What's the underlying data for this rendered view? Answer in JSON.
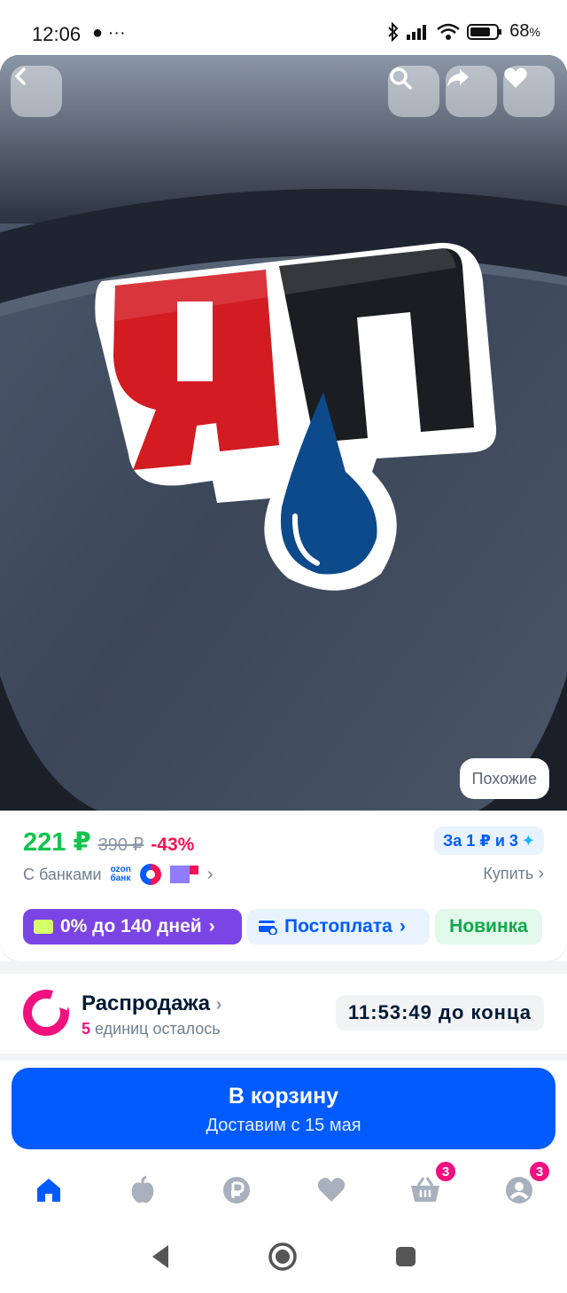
{
  "status_bar": {
    "time": "12:06",
    "extra": "●  ···",
    "battery": "68",
    "battery_unit": "%",
    "icons": [
      "bluetooth-icon",
      "signal-icon",
      "wifi-icon",
      "battery-icon"
    ]
  },
  "hero": {
    "logo_letters": "ЯП",
    "similar_label": "Похожие",
    "buttons": [
      "back-icon",
      "search-icon",
      "share-icon",
      "heart-icon"
    ]
  },
  "price": {
    "current": "221 ₽",
    "old": "390 ₽",
    "discount": "-43%",
    "promo": "За 1 ₽ и 3",
    "banks_label": "С банками",
    "ozon_bank_line1": "ozon",
    "ozon_bank_line2": "банк",
    "buy_label": "Купить",
    "chevron": "›"
  },
  "badges": {
    "installment": "0% до 140 дней",
    "postpay": "Постоплата",
    "new": "Новинка"
  },
  "sale": {
    "title": "Распродажа",
    "count": "5",
    "remaining_text": " единиц осталось",
    "timer": "11:53:49 до конца"
  },
  "cart": {
    "title": "В корзину",
    "subtitle": "Доставим с 15 мая"
  },
  "bottom_nav": {
    "items": [
      "home-icon",
      "fresh-icon",
      "finance-icon",
      "favorites-icon",
      "cart-icon",
      "profile-icon"
    ],
    "cart_badge": "3",
    "profile_badge": "3"
  },
  "colors": {
    "accent": "#005bff",
    "price_green": "#10c44c",
    "discount_pink": "#f91155",
    "sale_pink": "#f1117e",
    "installment_purple": "#7b45e5"
  }
}
